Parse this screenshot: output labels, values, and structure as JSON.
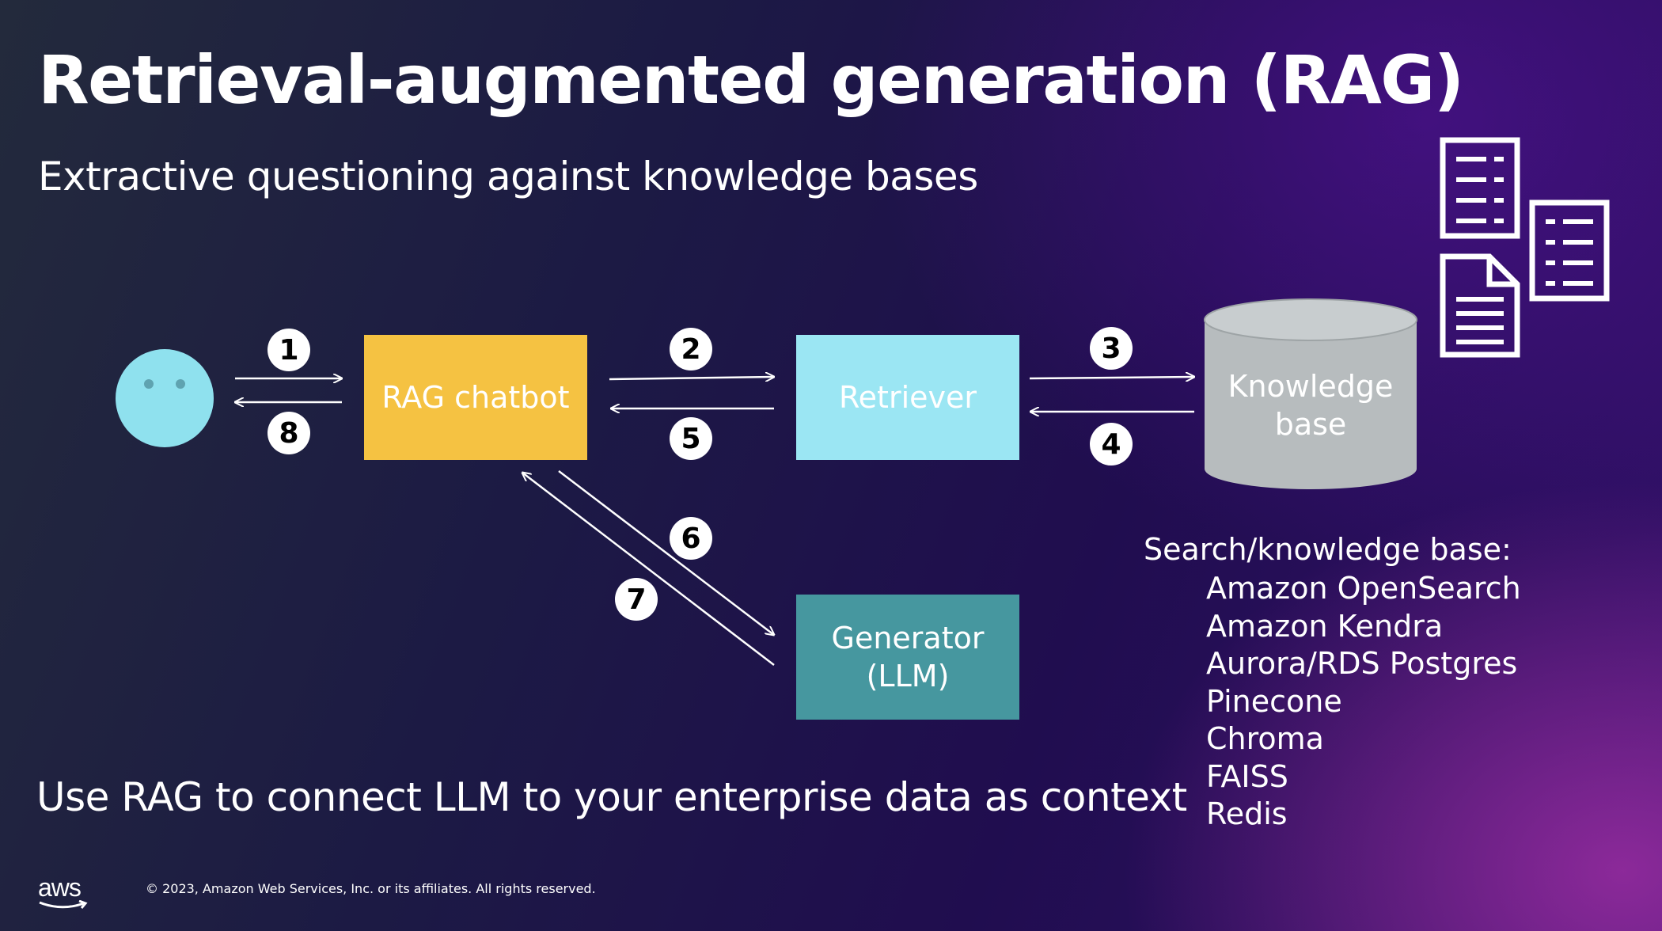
{
  "title": "Retrieval-augmented generation (RAG)",
  "subtitle": "Extractive questioning against knowledge bases",
  "nodes": {
    "chatbot": "RAG chatbot",
    "retriever": "Retriever",
    "generator": "Generator\n(LLM)",
    "knowledge_base": "Knowledge\nbase"
  },
  "steps": [
    "1",
    "2",
    "3",
    "4",
    "5",
    "6",
    "7",
    "8"
  ],
  "kb_list": {
    "heading": "Search/knowledge base:",
    "items": [
      "Amazon OpenSearch",
      "Amazon Kendra",
      "Aurora/RDS Postgres",
      "Pinecone",
      "Chroma",
      "FAISS",
      "Redis"
    ]
  },
  "footer_tagline": "Use RAG to connect LLM to your enterprise data as context",
  "copyright": "© 2023, Amazon Web Services, Inc. or its affiliates. All rights reserved.",
  "logo_text": "aws",
  "colors": {
    "chatbot": "#f5c242",
    "retriever": "#9be6f3",
    "generator": "#46979f",
    "user": "#8fe1ee",
    "knowledge_base": "#b7bcbe"
  },
  "icons": [
    "user-face-icon",
    "document-list-icon",
    "document-list-icon",
    "document-file-icon",
    "database-cylinder-icon"
  ]
}
